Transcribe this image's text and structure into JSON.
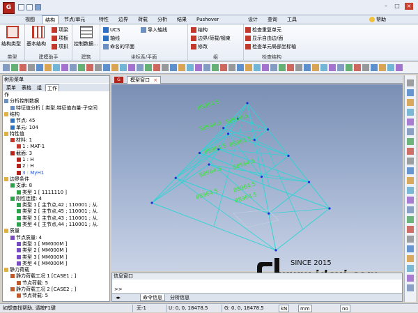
{
  "app": {
    "icon_text": "G"
  },
  "menus": [
    "视图",
    "结构",
    "节点/单元",
    "特性",
    "边界",
    "荷载",
    "分析",
    "结果",
    "Pushover",
    "设计",
    "查询",
    "工具"
  ],
  "help_label": "帮助",
  "ribbon": {
    "groups": [
      "类型",
      "建模助手",
      "建筑",
      "坐标系/平面",
      "组",
      "检查结构"
    ],
    "type_btn": "结构类型",
    "wizard_big": "基本结构",
    "wizard_items": [
      "项梁",
      "项板",
      "项拱"
    ],
    "control_btn": "控制数据...",
    "coord_items": [
      "UCS",
      "轴线",
      "命名的平面"
    ],
    "axis_import": "导入轴线",
    "group_items": [
      "结构",
      "边界/荷载/钢束",
      "修改"
    ],
    "check_items": [
      "检查重复单元",
      "显示自由边/面",
      "检查单元局部坐标轴"
    ]
  },
  "panel": {
    "title": "树形菜单",
    "tabs": [
      "菜单",
      "表格",
      "组",
      "工作"
    ],
    "tree": [
      {
        "text": "作",
        "lvl": 0,
        "ic": ""
      },
      {
        "text": "分析控制数据",
        "lvl": 0,
        "ic": "doc"
      },
      {
        "text": "特征值分析 [ 类型,特征值向量-子空间",
        "lvl": 1,
        "ic": "doc"
      },
      {
        "text": "结构",
        "lvl": 0,
        "ic": "folder"
      },
      {
        "text": "节点: 45",
        "lvl": 1,
        "ic": "dot"
      },
      {
        "text": "单元: 104",
        "lvl": 1,
        "ic": "dot"
      },
      {
        "text": "特性值",
        "lvl": 0,
        "ic": "folder"
      },
      {
        "text": "材料: 1",
        "lvl": 1,
        "ic": "mat"
      },
      {
        "text": "1 : MAT-1",
        "lvl": 2,
        "ic": "mat"
      },
      {
        "text": "截面: 3",
        "lvl": 1,
        "ic": "sec"
      },
      {
        "text": "1 : H",
        "lvl": 2,
        "ic": "sec"
      },
      {
        "text": "2 : H",
        "lvl": 2,
        "ic": "sec"
      },
      {
        "text": "3 : MyH1",
        "lvl": 2,
        "ic": "sec",
        "blue": true
      },
      {
        "text": "边界条件",
        "lvl": 0,
        "ic": "folder"
      },
      {
        "text": "支承: 8",
        "lvl": 1,
        "ic": "bnd"
      },
      {
        "text": "类型 1 [ 1111110 ]",
        "lvl": 2,
        "ic": "bnd"
      },
      {
        "text": "刚性连接: 4",
        "lvl": 1,
        "ic": "bnd"
      },
      {
        "text": "类型 1 [ 主节点,42 ; 110001 ; 从.",
        "lvl": 2,
        "ic": "bnd"
      },
      {
        "text": "类型 2 [ 主节点,45 ; 110001 ; 从.",
        "lvl": 2,
        "ic": "bnd"
      },
      {
        "text": "类型 3 [ 主节点,43 ; 110001 ; 从.",
        "lvl": 2,
        "ic": "bnd"
      },
      {
        "text": "类型 4 [ 主节点,44 ; 110001 ; 从.",
        "lvl": 2,
        "ic": "bnd"
      },
      {
        "text": "质量",
        "lvl": 0,
        "ic": "folder"
      },
      {
        "text": "节点质量: 4",
        "lvl": 1,
        "ic": "mass"
      },
      {
        "text": "类型 1 [ MM000M ]",
        "lvl": 2,
        "ic": "mass"
      },
      {
        "text": "类型 2 [ MM000M ]",
        "lvl": 2,
        "ic": "mass"
      },
      {
        "text": "类型 3 [ MM000M ]",
        "lvl": 2,
        "ic": "mass"
      },
      {
        "text": "类型 4 [ MM000M ]",
        "lvl": 2,
        "ic": "mass"
      },
      {
        "text": "静力荷载",
        "lvl": 0,
        "ic": "folder"
      },
      {
        "text": "静力荷载工况 1 [CASE1 ; ]",
        "lvl": 1,
        "ic": "load"
      },
      {
        "text": "节点荷载: 5",
        "lvl": 2,
        "ic": "load"
      },
      {
        "text": "静力荷载工况 2 [CASE2 ; ]",
        "lvl": 1,
        "ic": "load"
      },
      {
        "text": "节点荷载: 5",
        "lvl": 2,
        "ic": "load"
      }
    ]
  },
  "view": {
    "tab": "模型窗口",
    "load_labels": [
      "88964.5",
      "88964.5",
      "88964.5",
      "88964.5",
      "88964.5",
      "88964.5",
      "88964.5",
      "88964.5",
      "88964.5",
      "88964.5"
    ]
  },
  "messages": {
    "title": "信息窗口",
    "prompt": ">>",
    "tabs": [
      "命令信息",
      "分析信息"
    ]
  },
  "status": {
    "help": "如想查找帮助, 请按F1键",
    "sel": "无-1",
    "u": "U: 0, 0, 18478.5",
    "g": "G: 0, 0, 18478.5",
    "unit": "kN",
    "unit2": "mm",
    "extra": "no"
  },
  "watermark": {
    "since": "SINCE 2015",
    "site": "www.jdcui.com"
  },
  "colors": {
    "load_text": "#3ce23c",
    "frame": "#2fd4d4",
    "node": "#1a2fd4",
    "accent": "#b2231b"
  }
}
